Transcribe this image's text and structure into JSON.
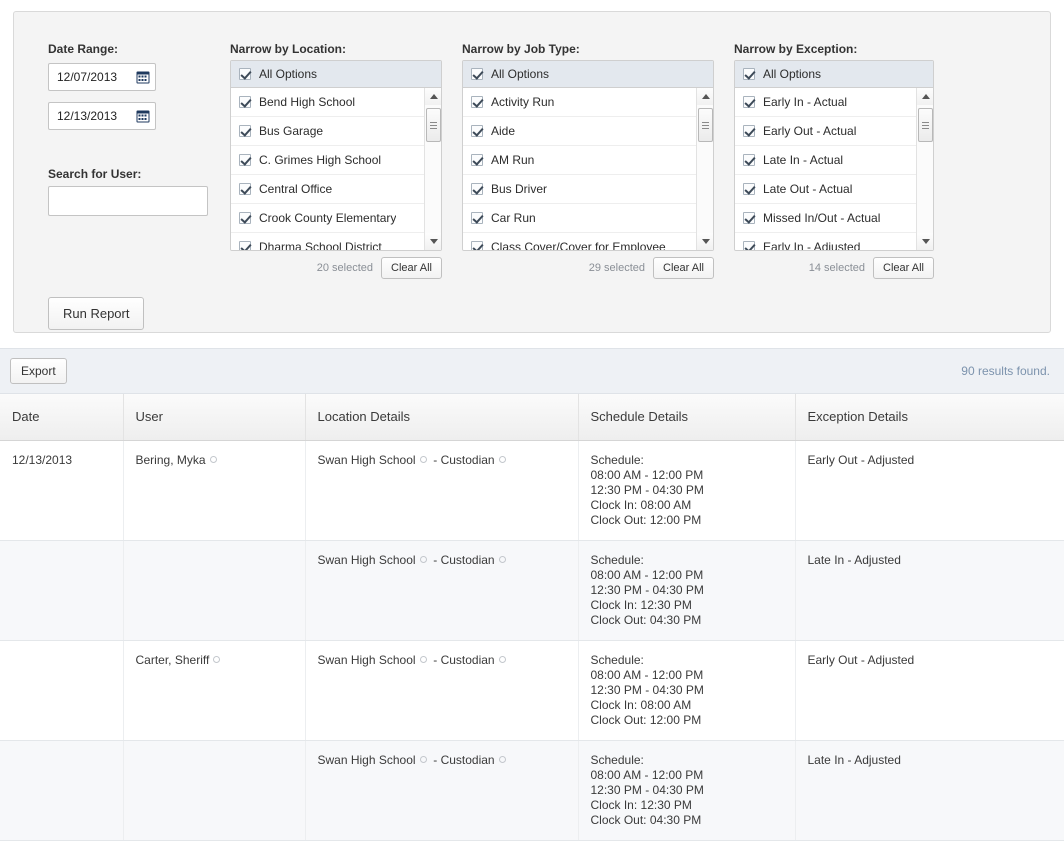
{
  "filters": {
    "date_range": {
      "label": "Date Range:",
      "start": "12/07/2013",
      "end": "12/13/2013",
      "icon": "calendar-icon"
    },
    "search_user": {
      "label": "Search for User:",
      "value": "",
      "placeholder": ""
    },
    "location": {
      "label": "Narrow by Location:",
      "all_options": "All Options",
      "items": [
        "Bend High School",
        "Bus Garage",
        "C. Grimes High School",
        "Central Office",
        "Crook County Elementary",
        "Dharma School District"
      ],
      "selected_text": "20 selected",
      "clear_all": "Clear All"
    },
    "job_type": {
      "label": "Narrow by Job Type:",
      "all_options": "All Options",
      "items": [
        "Activity Run",
        "Aide",
        "AM Run",
        "Bus Driver",
        "Car Run",
        "Class Cover/Cover for Employee"
      ],
      "selected_text": "29 selected",
      "clear_all": "Clear All"
    },
    "exception": {
      "label": "Narrow by Exception:",
      "all_options": "All Options",
      "items": [
        "Early In - Actual",
        "Early Out - Actual",
        "Late In - Actual",
        "Late Out - Actual",
        "Missed In/Out - Actual",
        "Early In - Adjusted"
      ],
      "selected_text": "14 selected",
      "clear_all": "Clear All"
    },
    "run_report_label": "Run Report"
  },
  "results": {
    "export_label": "Export",
    "count_text": "90 results found.",
    "columns": [
      "Date",
      "User",
      "Location Details",
      "Schedule Details",
      "Exception Details"
    ],
    "rows": [
      {
        "date": "12/13/2013",
        "user": "Bering, Myka",
        "location": "Swan High School",
        "job": "- Custodian",
        "schedule_label": "Schedule:",
        "shift1": "08:00 AM - 12:00 PM",
        "shift2": "12:30 PM - 04:30 PM",
        "clock_in": "Clock In: 08:00 AM",
        "clock_out": "Clock Out: 12:00 PM",
        "exception": "Early Out - Adjusted"
      },
      {
        "date": "",
        "user": "",
        "location": "Swan High School",
        "job": "- Custodian",
        "schedule_label": "Schedule:",
        "shift1": "08:00 AM - 12:00 PM",
        "shift2": "12:30 PM - 04:30 PM",
        "clock_in": "Clock In: 12:30 PM",
        "clock_out": "Clock Out: 04:30 PM",
        "exception": "Late In - Adjusted"
      },
      {
        "date": "",
        "user": "Carter, Sheriff",
        "location": "Swan High School",
        "job": "- Custodian",
        "schedule_label": "Schedule:",
        "shift1": "08:00 AM - 12:00 PM",
        "shift2": "12:30 PM - 04:30 PM",
        "clock_in": "Clock In: 08:00 AM",
        "clock_out": "Clock Out: 12:00 PM",
        "exception": "Early Out - Adjusted"
      },
      {
        "date": "",
        "user": "",
        "location": "Swan High School",
        "job": "- Custodian",
        "schedule_label": "Schedule:",
        "shift1": "08:00 AM - 12:00 PM",
        "shift2": "12:30 PM - 04:30 PM",
        "clock_in": "Clock In: 12:30 PM",
        "clock_out": "Clock Out: 04:30 PM",
        "exception": "Late In - Adjusted"
      }
    ]
  },
  "colors": {
    "panel_bg": "#f4f4f4",
    "all_options_bg": "#e3e8ee",
    "results_bar_bg": "#eef1f5",
    "results_count_color": "#7c93ad",
    "row_alt_bg": "#f7f8fa"
  }
}
